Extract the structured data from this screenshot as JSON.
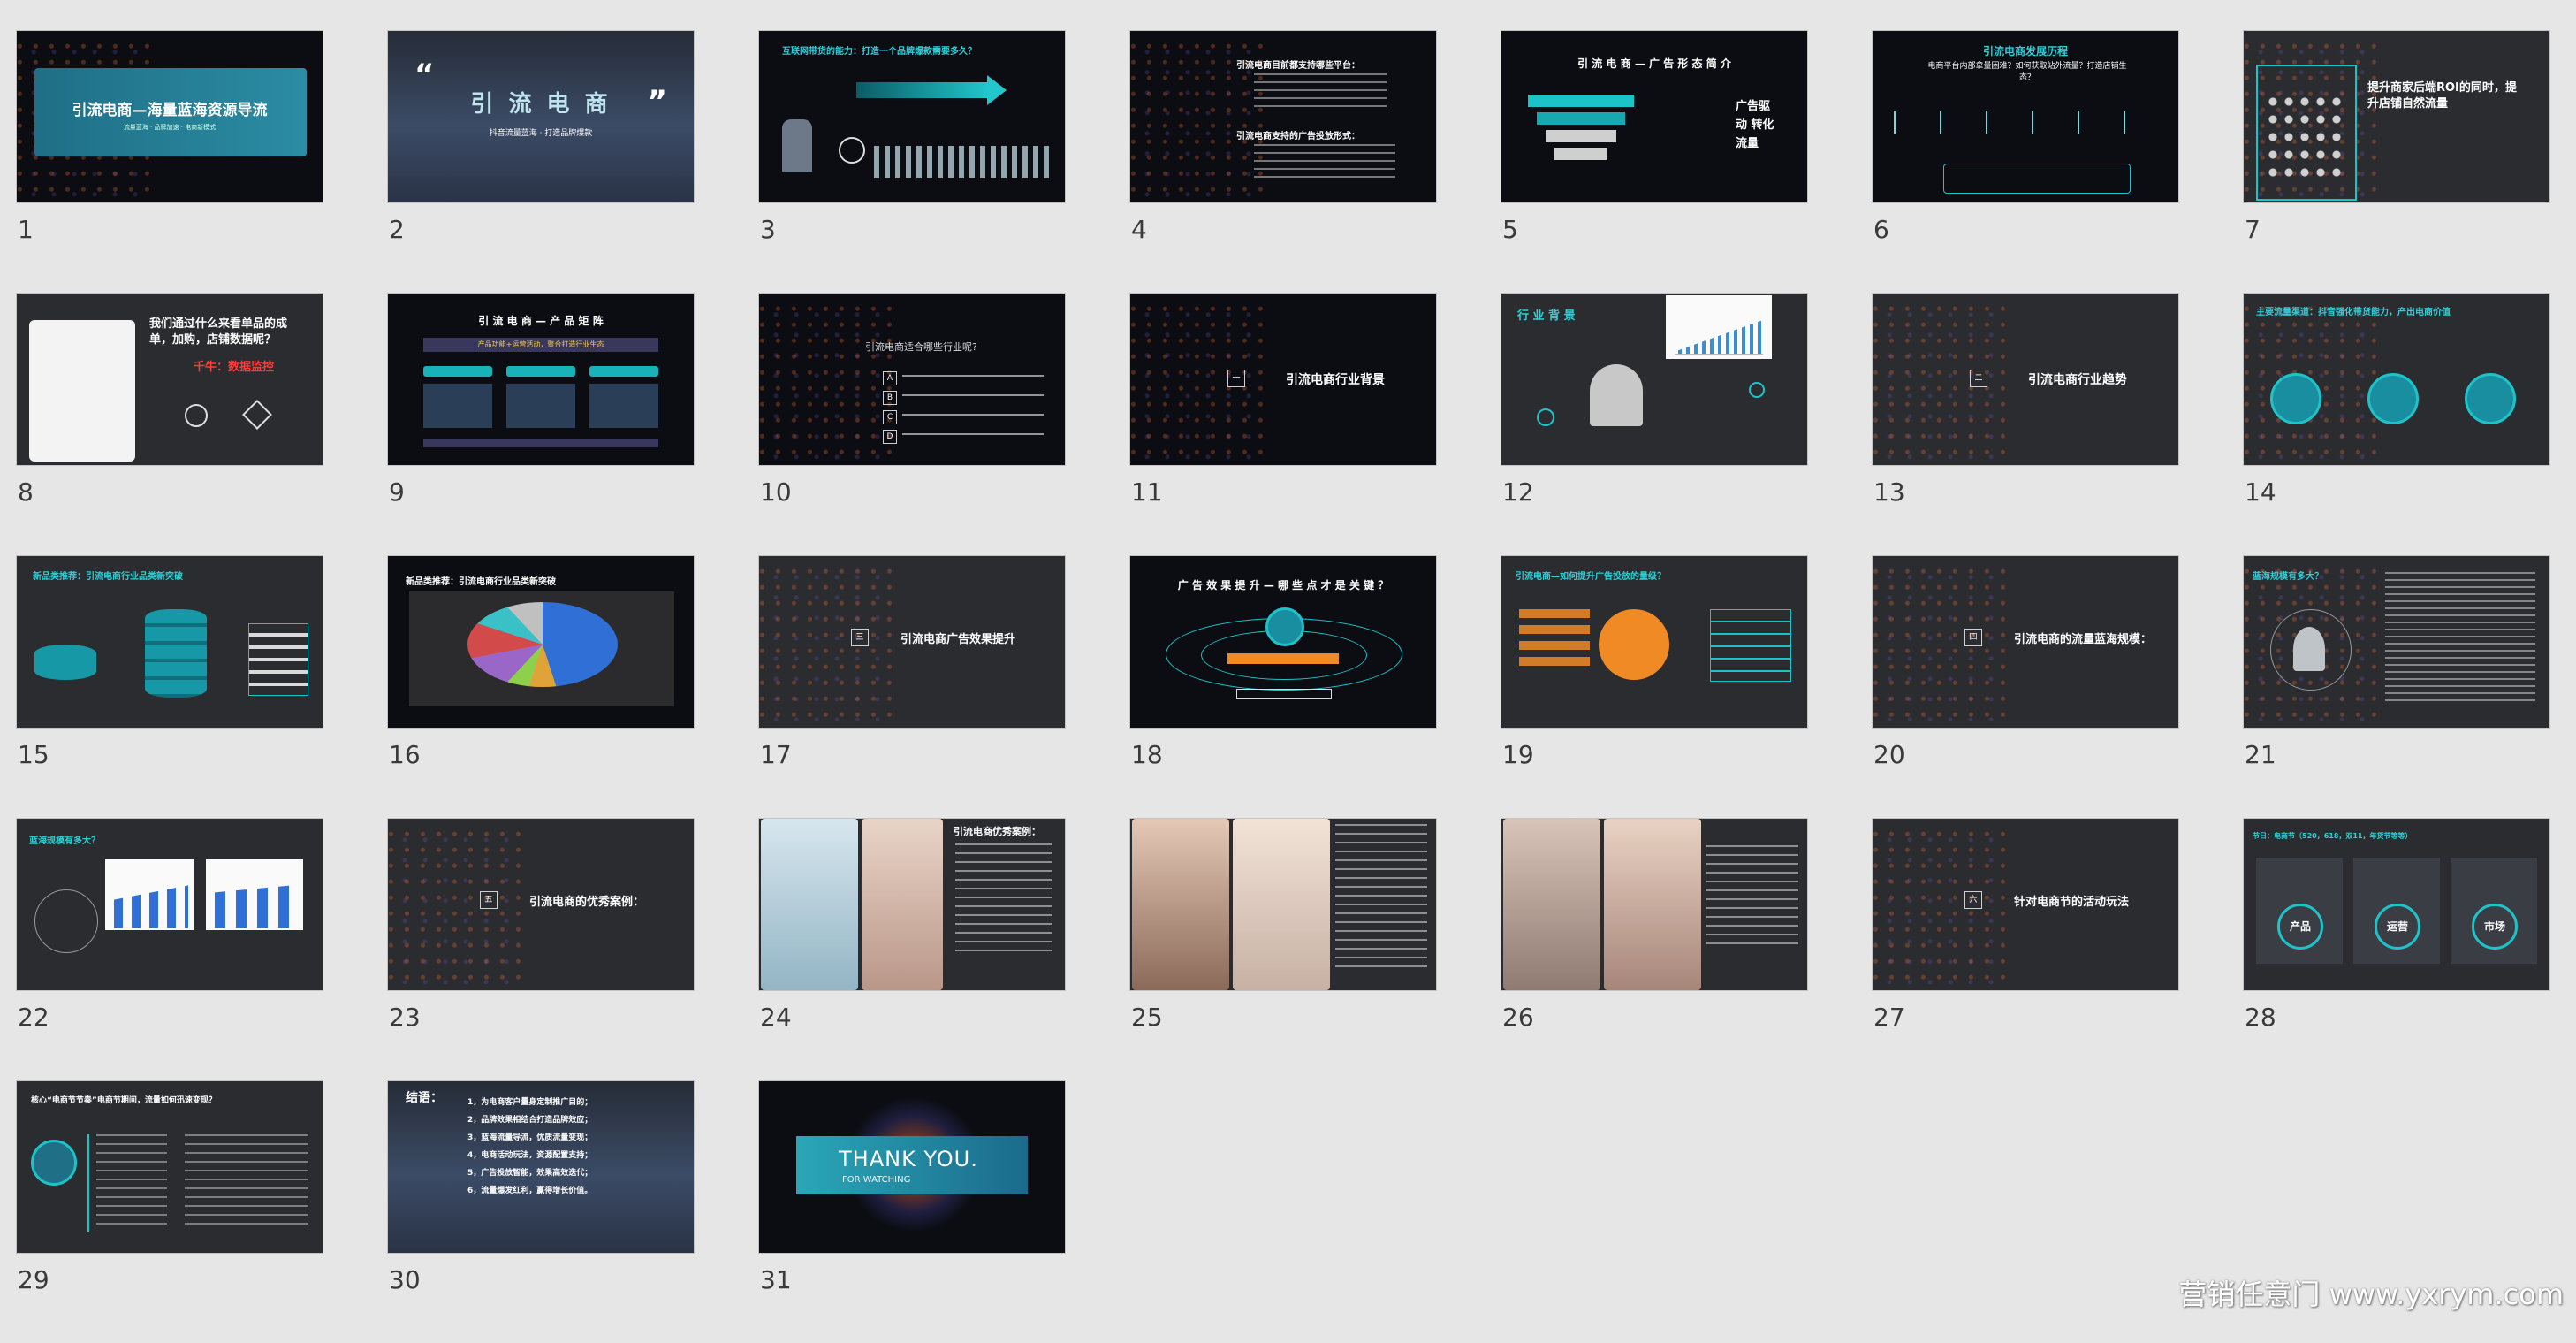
{
  "slides": [
    {
      "n": "1",
      "title": "引流电商—海量蓝海资源导流",
      "subtitle": "流量蓝海 · 品牌加速 · 电商新模式"
    },
    {
      "n": "2",
      "title": "引 流 电 商",
      "subtitle": "抖音流量蓝海 · 打造品牌爆款"
    },
    {
      "n": "3",
      "title": "互联网带货的能力：打造一个品牌爆款需要多久？"
    },
    {
      "n": "4",
      "title": "引流电商目前都支持哪些平台：",
      "subtitle": "引流电商支持的广告投放形式："
    },
    {
      "n": "5",
      "title": "引 流 电 商 — 广 告 形 态 简 介",
      "quote": "广告驱动 转化流量"
    },
    {
      "n": "6",
      "title": "引流电商发展历程",
      "subtitle": "电商平台内部拿量困难？如何获取站外流量？打造店铺生态？"
    },
    {
      "n": "7",
      "title": "提升商家后端ROI的同时，提升店铺自然流量"
    },
    {
      "n": "8",
      "title": "我们通过什么来看单品的成单，加购，店铺数据呢？",
      "highlight": "千牛：数据监控"
    },
    {
      "n": "9",
      "title": "引 流 电 商 — 产 品 矩 阵",
      "subtitle": "产品功能+运营活动，聚合打造行业生态"
    },
    {
      "n": "10",
      "title": "引流电商适合哪些行业呢?"
    },
    {
      "n": "11",
      "section": "一",
      "title": "引流电商行业背景"
    },
    {
      "n": "12",
      "title": "行 业 背 景"
    },
    {
      "n": "13",
      "section": "二",
      "title": "引流电商行业趋势"
    },
    {
      "n": "14",
      "title": "主要流量渠道：抖音强化带货能力，产出电商价值"
    },
    {
      "n": "15",
      "title": "新品类推荐：引流电商行业品类新突破"
    },
    {
      "n": "16",
      "title": "新品类推荐：引流电商行业品类新突破"
    },
    {
      "n": "17",
      "section": "三",
      "title": "引流电商广告效果提升"
    },
    {
      "n": "18",
      "title": "广 告 效 果 提 升 — 哪 些 点 才 是 关 键 ？"
    },
    {
      "n": "19",
      "title": "引流电商—如何提升广告投放的量级？"
    },
    {
      "n": "20",
      "section": "四",
      "title": "引流电商的流量蓝海规模："
    },
    {
      "n": "21",
      "title": "蓝海规模有多大？"
    },
    {
      "n": "22",
      "title": "蓝海规模有多大？"
    },
    {
      "n": "23",
      "section": "五",
      "title": "引流电商的优秀案例："
    },
    {
      "n": "24",
      "title": "引流电商优秀案例："
    },
    {
      "n": "25",
      "title": ""
    },
    {
      "n": "26",
      "title": ""
    },
    {
      "n": "27",
      "section": "六",
      "title": "针对电商节的活动玩法"
    },
    {
      "n": "28",
      "title": "节日：电商节（520，618，双11，年货节等等）",
      "pills": [
        "产品",
        "运营",
        "市场"
      ]
    },
    {
      "n": "29",
      "title": "核心“电商节节奏”电商节期间，流量如何迅速变现？"
    },
    {
      "n": "30",
      "title": "结语：",
      "items": [
        "1，为电商客户量身定制推广目的；",
        "2，品牌效果相结合打造品牌效应；",
        "3，蓝海流量导流，优质流量变现；",
        "4，电商活动玩法，资源配置支持；",
        "5，广告投放智能，效果高效迭代；",
        "6，流量爆发红利，赢得增长价值。"
      ]
    },
    {
      "n": "31",
      "title": "THANK YOU.",
      "subtitle": "FOR WATCHING"
    }
  ],
  "watermark": "营销任意门 www.yxrym.com",
  "colors": {
    "accent": "#2fd0d8",
    "background": "#e6e6e6",
    "slide_dark": "#0b0d12"
  }
}
